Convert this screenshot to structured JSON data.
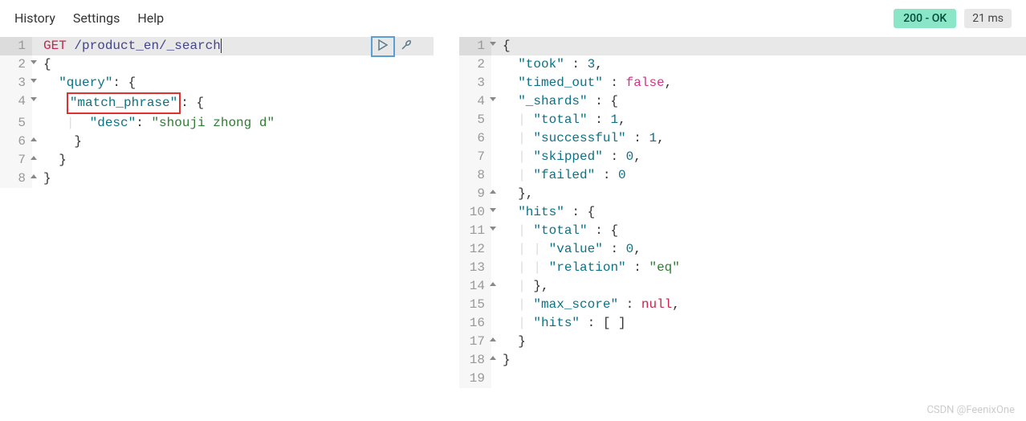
{
  "menu": {
    "history": "History",
    "settings": "Settings",
    "help": "Help"
  },
  "status": {
    "code": "200 - OK",
    "time": "21 ms"
  },
  "request": {
    "method": "GET",
    "path": "/product_en/_search",
    "lines": {
      "l2": "{",
      "l3_key": "\"query\"",
      "l3_rest": ": {",
      "l4_key": "\"match_phrase\"",
      "l4_rest": ": {",
      "l5_key": "\"desc\"",
      "l5_colon": ": ",
      "l5_val": "\"shouji zhong d\"",
      "l6": "    }",
      "l7": "  }",
      "l8": "}"
    }
  },
  "response": {
    "l1": "{",
    "l2_key": "\"took\"",
    "l2_val": "3",
    "l3_key": "\"timed_out\"",
    "l3_val": "false",
    "l4_key": "\"_shards\"",
    "l5_key": "\"total\"",
    "l5_val": "1",
    "l6_key": "\"successful\"",
    "l6_val": "1",
    "l7_key": "\"skipped\"",
    "l7_val": "0",
    "l8_key": "\"failed\"",
    "l8_val": "0",
    "l10_key": "\"hits\"",
    "l11_key": "\"total\"",
    "l12_key": "\"value\"",
    "l12_val": "0",
    "l13_key": "\"relation\"",
    "l13_val": "\"eq\"",
    "l15_key": "\"max_score\"",
    "l15_val": "null",
    "l16_key": "\"hits\"",
    "l16_val": "[ ]"
  },
  "watermark": "CSDN @FeenixOne"
}
